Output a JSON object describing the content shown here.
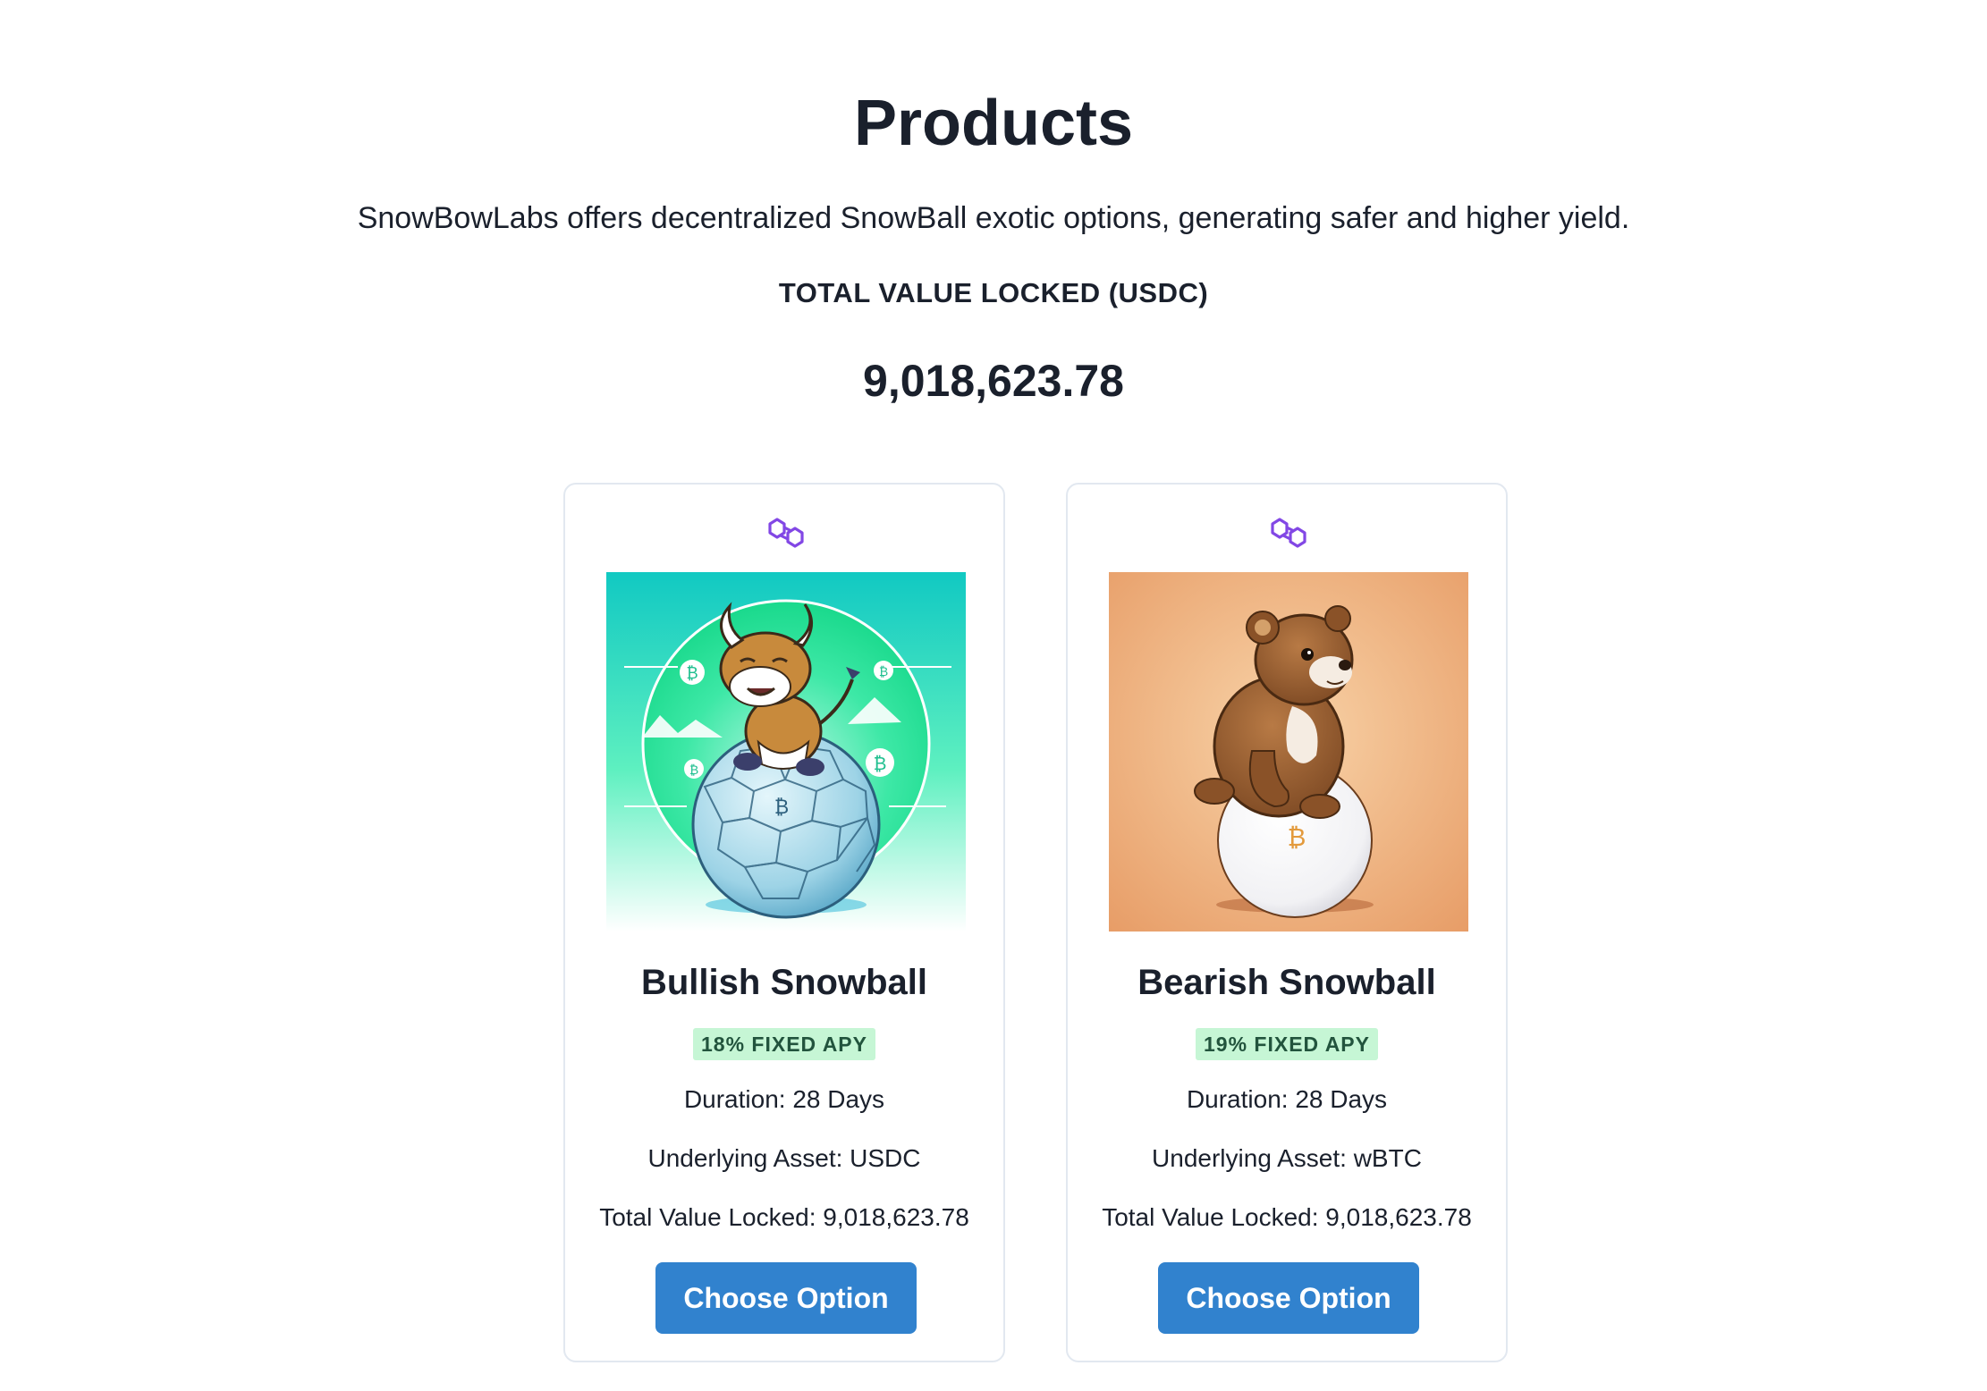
{
  "header": {
    "title": "Products",
    "subtitle": "SnowBowLabs offers decentralized SnowBall exotic options, generating safer and higher yield.",
    "tvl_label": "TOTAL VALUE LOCKED (USDC)",
    "tvl_value": "9,018,623.78"
  },
  "cards": [
    {
      "chain_icon": "polygon-icon",
      "image": "bull-on-snowball-illustration",
      "title": "Bullish Snowball",
      "apy": "18% FIXED APY",
      "duration": "Duration: 28 Days",
      "underlying": "Underlying Asset: USDC",
      "tvl": "Total Value Locked: 9,018,623.78",
      "button": "Choose Option"
    },
    {
      "chain_icon": "polygon-icon",
      "image": "bear-on-snowball-illustration",
      "title": "Bearish Snowball",
      "apy": "19% FIXED APY",
      "duration": "Duration: 28 Days",
      "underlying": "Underlying Asset: wBTC",
      "tvl": "Total Value Locked: 9,018,623.78",
      "button": "Choose Option"
    }
  ],
  "colors": {
    "accent": "#3182ce",
    "badge_bg": "#c6f6d5",
    "badge_text": "#22543d",
    "polygon": "#8247e5"
  }
}
